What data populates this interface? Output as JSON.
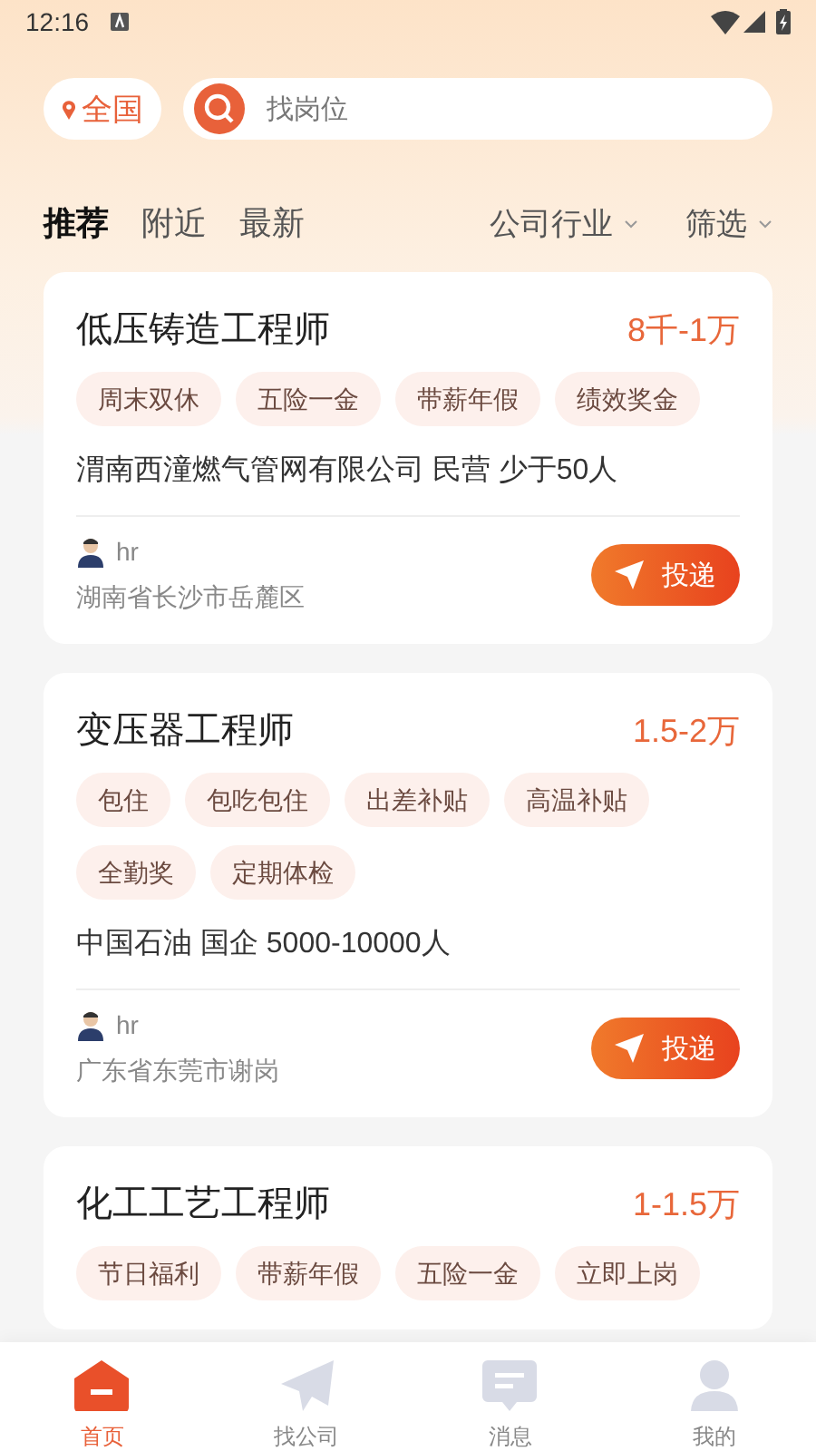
{
  "status_bar": {
    "time": "12:16"
  },
  "location": "全国",
  "search": {
    "placeholder": "找岗位"
  },
  "tabs": [
    {
      "label": "推荐",
      "selected": true
    },
    {
      "label": "附近",
      "selected": false
    },
    {
      "label": "最新",
      "selected": false
    }
  ],
  "filters": [
    "公司行业",
    "筛选"
  ],
  "jobs": [
    {
      "title": "低压铸造工程师",
      "salary": "8千-1万",
      "tags": [
        "周末双休",
        "五险一金",
        "带薪年假",
        "绩效奖金"
      ],
      "company": "渭南西潼燃气管网有限公司 民营 少于50人",
      "recruiter": "hr",
      "address": "湖南省长沙市岳麓区",
      "action": "投递"
    },
    {
      "title": "变压器工程师",
      "salary": "1.5-2万",
      "tags": [
        "包住",
        "包吃包住",
        "出差补贴",
        "高温补贴",
        "全勤奖",
        "定期体检"
      ],
      "company": "中国石油 国企 5000-10000人",
      "recruiter": "hr",
      "address": "广东省东莞市谢岗",
      "action": "投递"
    },
    {
      "title": "化工工艺工程师",
      "salary": "1-1.5万",
      "tags": [
        "节日福利",
        "带薪年假",
        "五险一金",
        "立即上岗"
      ]
    }
  ],
  "nav": [
    {
      "label": "首页",
      "selected": true,
      "kind": "home"
    },
    {
      "label": "找公司",
      "selected": false,
      "kind": "plane"
    },
    {
      "label": "消息",
      "selected": false,
      "kind": "chat"
    },
    {
      "label": "我的",
      "selected": false,
      "kind": "person"
    }
  ]
}
